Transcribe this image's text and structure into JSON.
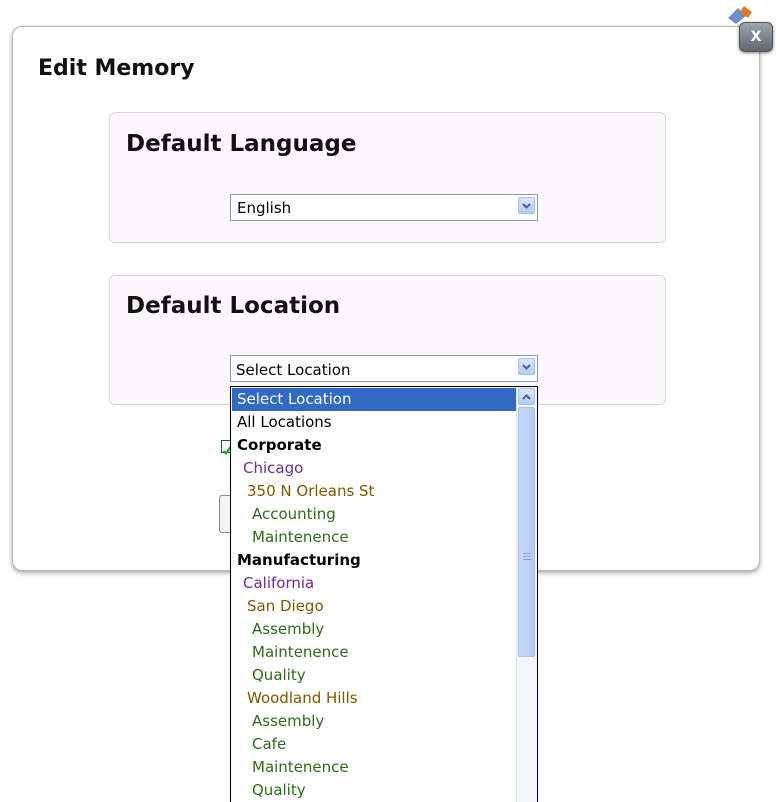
{
  "dialog": {
    "title": "Edit Memory",
    "close_label": "X"
  },
  "language_section": {
    "heading": "Default Language",
    "selected_value": "English"
  },
  "location_section": {
    "heading": "Default Location",
    "selected_value": "Select Location"
  },
  "location_options": [
    {
      "label": "Select Location",
      "kind": "selected"
    },
    {
      "label": "All Locations",
      "kind": "plain"
    },
    {
      "label": "Corporate",
      "kind": "group"
    },
    {
      "label": "Chicago",
      "kind": "lvl1"
    },
    {
      "label": "350 N Orleans St",
      "kind": "lvl2"
    },
    {
      "label": "Accounting",
      "kind": "lvl3"
    },
    {
      "label": "Maintenence",
      "kind": "lvl3"
    },
    {
      "label": "Manufacturing",
      "kind": "group"
    },
    {
      "label": "California",
      "kind": "lvl1"
    },
    {
      "label": "San Diego",
      "kind": "lvl2"
    },
    {
      "label": "Assembly",
      "kind": "lvl3"
    },
    {
      "label": "Maintenence",
      "kind": "lvl3"
    },
    {
      "label": "Quality",
      "kind": "lvl3"
    },
    {
      "label": "Woodland Hills",
      "kind": "lvl2"
    },
    {
      "label": "Assembly",
      "kind": "lvl3"
    },
    {
      "label": "Cafe",
      "kind": "lvl3"
    },
    {
      "label": "Maintenence",
      "kind": "lvl3"
    },
    {
      "label": "Quality",
      "kind": "lvl3"
    }
  ],
  "colors": {
    "selected_highlight": "#316ac5",
    "region_text": "#6b2d8a",
    "site_text": "#7a5a00",
    "department_text": "#2d6b1a",
    "section_background": "#fcf7fc"
  },
  "icons": {
    "close": "close-icon",
    "dropdown_arrow": "chevron-down-icon",
    "scroll_up": "chevron-up-icon"
  }
}
